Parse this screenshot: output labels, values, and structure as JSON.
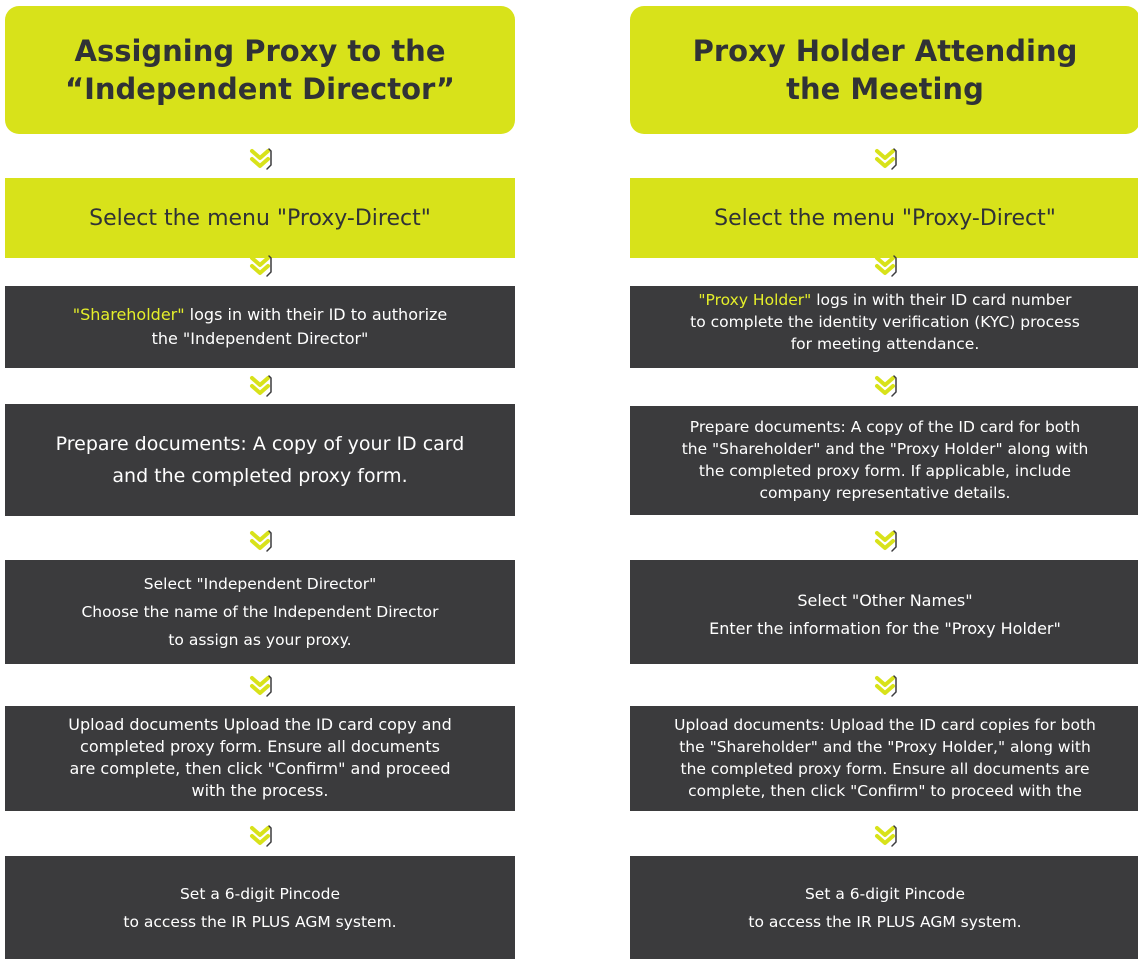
{
  "colors": {
    "accent": "#d8e21a",
    "dark_box": "#3b3b3d",
    "highlight_text": "#e5ef2a",
    "title_text": "#303236",
    "body_text": "#ffffff"
  },
  "left": {
    "title_line1": "Assigning Proxy to the",
    "title_line2": "“Independent Director”",
    "menu": "Select the menu \"Proxy-Direct\"",
    "step1": {
      "highlight": "\"Shareholder\"",
      "rest": " logs in with their ID to authorize",
      "line2": "the \"Independent Director\""
    },
    "step2": {
      "line1": "Prepare documents: A copy of your ID card",
      "line2": "and the completed proxy form."
    },
    "step3": {
      "line1": "Select \"Independent Director\"",
      "line2": "Choose the name of the Independent Director",
      "line3": "to assign as your proxy."
    },
    "step4": {
      "line1": "Upload documents Upload the ID card copy and",
      "line2": "completed proxy form. Ensure all documents",
      "line3": "are complete, then click \"Confirm\" and proceed",
      "line4": "with the process."
    },
    "step5": {
      "line1": "Set a 6-digit Pincode",
      "line2": "to access the IR PLUS AGM system."
    }
  },
  "right": {
    "title_line1": "Proxy Holder Attending",
    "title_line2": "the Meeting",
    "menu": "Select the menu \"Proxy-Direct\"",
    "step1": {
      "highlight": "\"Proxy Holder\"",
      "rest": " logs in with their ID card number",
      "line2": "to complete the identity verification (KYC) process",
      "line3": "for meeting attendance."
    },
    "step2": {
      "line1": "Prepare documents: A copy of the ID card for both",
      "line2": "the \"Shareholder\" and the \"Proxy Holder\" along with",
      "line3": "the completed proxy form. If applicable, include",
      "line4": "company representative details."
    },
    "step3": {
      "line1": "Select \"Other Names\"",
      "line2": "Enter the information for the \"Proxy Holder\""
    },
    "step4": {
      "line1": "Upload documents: Upload the ID card copies for both",
      "line2": "the \"Shareholder\" and the \"Proxy Holder,\" along with",
      "line3": "the completed proxy form. Ensure all documents are",
      "line4": "complete, then click \"Confirm\" to proceed with the"
    },
    "step5": {
      "line1": "Set a 6-digit Pincode",
      "line2": "to access the IR PLUS AGM system."
    }
  },
  "arrow_icon": "double-chevron-down-icon"
}
